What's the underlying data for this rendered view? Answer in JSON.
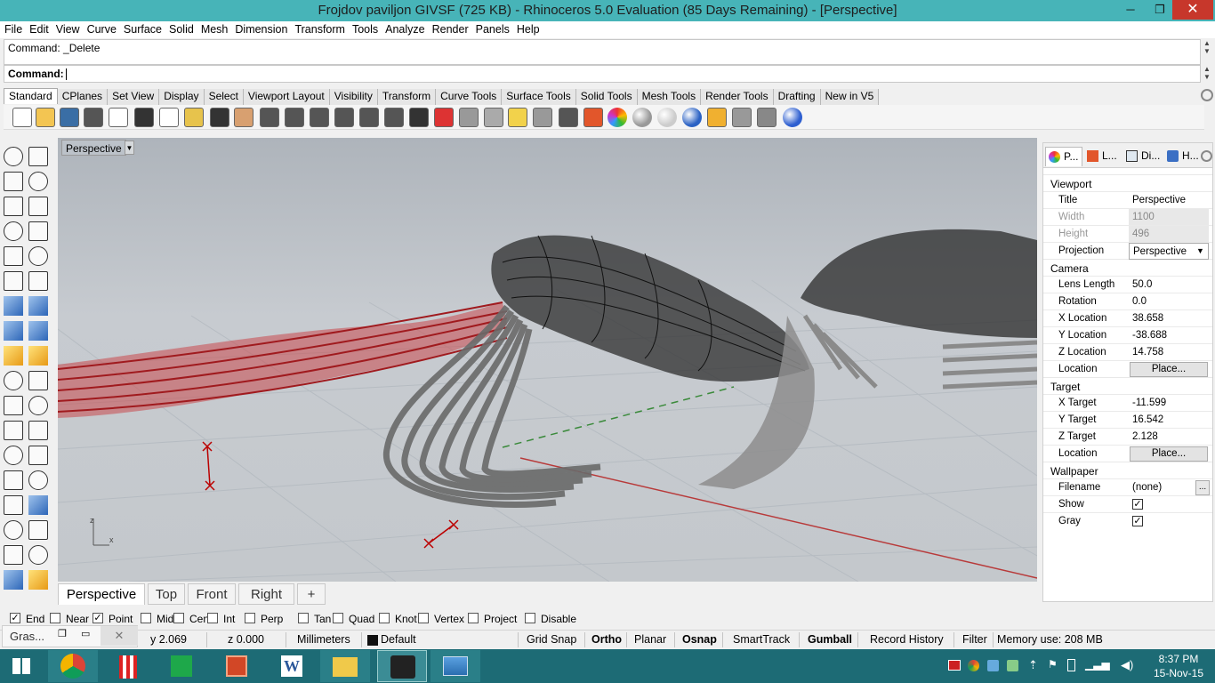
{
  "window": {
    "title": "Frojdov paviljon GIVSF (725 KB) - Rhinoceros 5.0 Evaluation (85 Days Remaining) - [Perspective]",
    "minimize": "─",
    "restore": "❐",
    "close": "✕"
  },
  "menu": [
    "File",
    "Edit",
    "View",
    "Curve",
    "Surface",
    "Solid",
    "Mesh",
    "Dimension",
    "Transform",
    "Tools",
    "Analyze",
    "Render",
    "Panels",
    "Help"
  ],
  "command": {
    "history": "Command: _Delete",
    "prompt": "Command:"
  },
  "toolbar_tabs": [
    "Standard",
    "CPlanes",
    "Set View",
    "Display",
    "Select",
    "Viewport Layout",
    "Visibility",
    "Transform",
    "Curve Tools",
    "Surface Tools",
    "Solid Tools",
    "Mesh Tools",
    "Render Tools",
    "Drafting",
    "New in V5"
  ],
  "toolbar_icons": [
    "new-icon",
    "open-icon",
    "save-icon",
    "print-icon",
    "import-icon",
    "cut-icon",
    "copy-icon",
    "paste-icon",
    "undo-icon",
    "pan-icon",
    "rotate-view-icon",
    "zoom-icon",
    "zoom-window-icon",
    "zoom-extents-icon",
    "zoom-selected-icon",
    "rotate-camera-icon",
    "four-viewports-icon",
    "car-icon",
    "snap-grid-icon",
    "osnap-icon",
    "point-light-icon",
    "spotlight-icon",
    "lock-icon",
    "materials-icon",
    "color-wheel-icon",
    "shaded-sphere-icon",
    "rendered-sphere-icon",
    "blue-sphere-icon",
    "selection-filter-icon",
    "settings-icon",
    "options-icon",
    "help-icon"
  ],
  "left_tools": [
    "select-arrow-icon",
    "point-icon",
    "polyline-icon",
    "curve-icon",
    "circle-icon",
    "ellipse-icon",
    "arc-icon",
    "rectangle-icon",
    "polygon-icon",
    "fillet-icon",
    "surface-corners-icon",
    "extrude-surface-icon",
    "box-icon",
    "sphere-icon",
    "cylinder-icon",
    "mesh-icon",
    "explode-icon",
    "boolean-icon",
    "split-icon",
    "trim-icon",
    "group-icon",
    "ungroup-icon",
    "move-icon",
    "rotate-icon",
    "text-icon",
    "dimension-icon",
    "array-icon",
    "mirror-icon",
    "block-icon",
    "hatch-icon",
    "grid-array-icon",
    "align-icon",
    "analyze-icon",
    "check-icon",
    "render-icon",
    "paint-icon"
  ],
  "viewport": {
    "label": "Perspective",
    "dropdown": "▼",
    "tabs": [
      "Perspective",
      "Top",
      "Front",
      "Right"
    ],
    "add_tab": "+"
  },
  "panel": {
    "tabs": [
      "P...",
      "L...",
      "Di...",
      "H..."
    ],
    "viewport_section": "Viewport",
    "viewport_rows": [
      {
        "key": "Title",
        "value": "Perspective"
      },
      {
        "key": "Width",
        "value": "1100"
      },
      {
        "key": "Height",
        "value": "496"
      },
      {
        "key": "Projection",
        "value": "Perspective"
      }
    ],
    "camera_section": "Camera",
    "camera_rows": [
      {
        "key": "Lens Length",
        "value": "50.0"
      },
      {
        "key": "Rotation",
        "value": "0.0"
      },
      {
        "key": "X Location",
        "value": "38.658"
      },
      {
        "key": "Y Location",
        "value": "-38.688"
      },
      {
        "key": "Z Location",
        "value": "14.758"
      },
      {
        "key": "Location",
        "value": "Place..."
      }
    ],
    "target_section": "Target",
    "target_rows": [
      {
        "key": "X Target",
        "value": "-11.599"
      },
      {
        "key": "Y Target",
        "value": "16.542"
      },
      {
        "key": "Z Target",
        "value": "2.128"
      },
      {
        "key": "Location",
        "value": "Place..."
      }
    ],
    "wallpaper_section": "Wallpaper",
    "wallpaper_rows": [
      {
        "key": "Filename",
        "value": "(none)"
      },
      {
        "key": "Show",
        "value": "✓"
      },
      {
        "key": "Gray",
        "value": "✓"
      }
    ],
    "ellipsis": "..."
  },
  "osnap": [
    {
      "label": "End",
      "checked": true
    },
    {
      "label": "Near",
      "checked": false
    },
    {
      "label": "Point",
      "checked": true
    },
    {
      "label": "Mid",
      "checked": false
    },
    {
      "label": "Cen",
      "checked": false
    },
    {
      "label": "Int",
      "checked": false
    },
    {
      "label": "Perp",
      "checked": false
    },
    {
      "label": "Tan",
      "checked": false
    },
    {
      "label": "Quad",
      "checked": false
    },
    {
      "label": "Knot",
      "checked": false
    },
    {
      "label": "Vertex",
      "checked": false
    },
    {
      "label": "Project",
      "checked": false
    },
    {
      "label": "Disable",
      "checked": false
    }
  ],
  "status": {
    "gras": "Gras...",
    "y": "y 2.069",
    "z": "z 0.000",
    "units": "Millimeters",
    "layer": "Default",
    "grid_snap": "Grid Snap",
    "ortho": "Ortho",
    "planar": "Planar",
    "osnap": "Osnap",
    "smarttrack": "SmartTrack",
    "gumball": "Gumball",
    "record_history": "Record History",
    "filter": "Filter",
    "memory": "Memory use: 208 MB"
  },
  "taskbar": {
    "apps": [
      "windows-start-icon",
      "chrome-icon",
      "popcorn-icon",
      "store-icon",
      "powerpoint-icon",
      "word-icon",
      "file-explorer-icon",
      "rhino-icon",
      "photos-icon"
    ],
    "time": "8:37 PM",
    "date": "15-Nov-15"
  },
  "colors": {
    "titlebar": "#47b4b8",
    "taskbar": "#1d6b75",
    "red_geometry": "#b52a2a",
    "close_button": "#c7372b"
  }
}
